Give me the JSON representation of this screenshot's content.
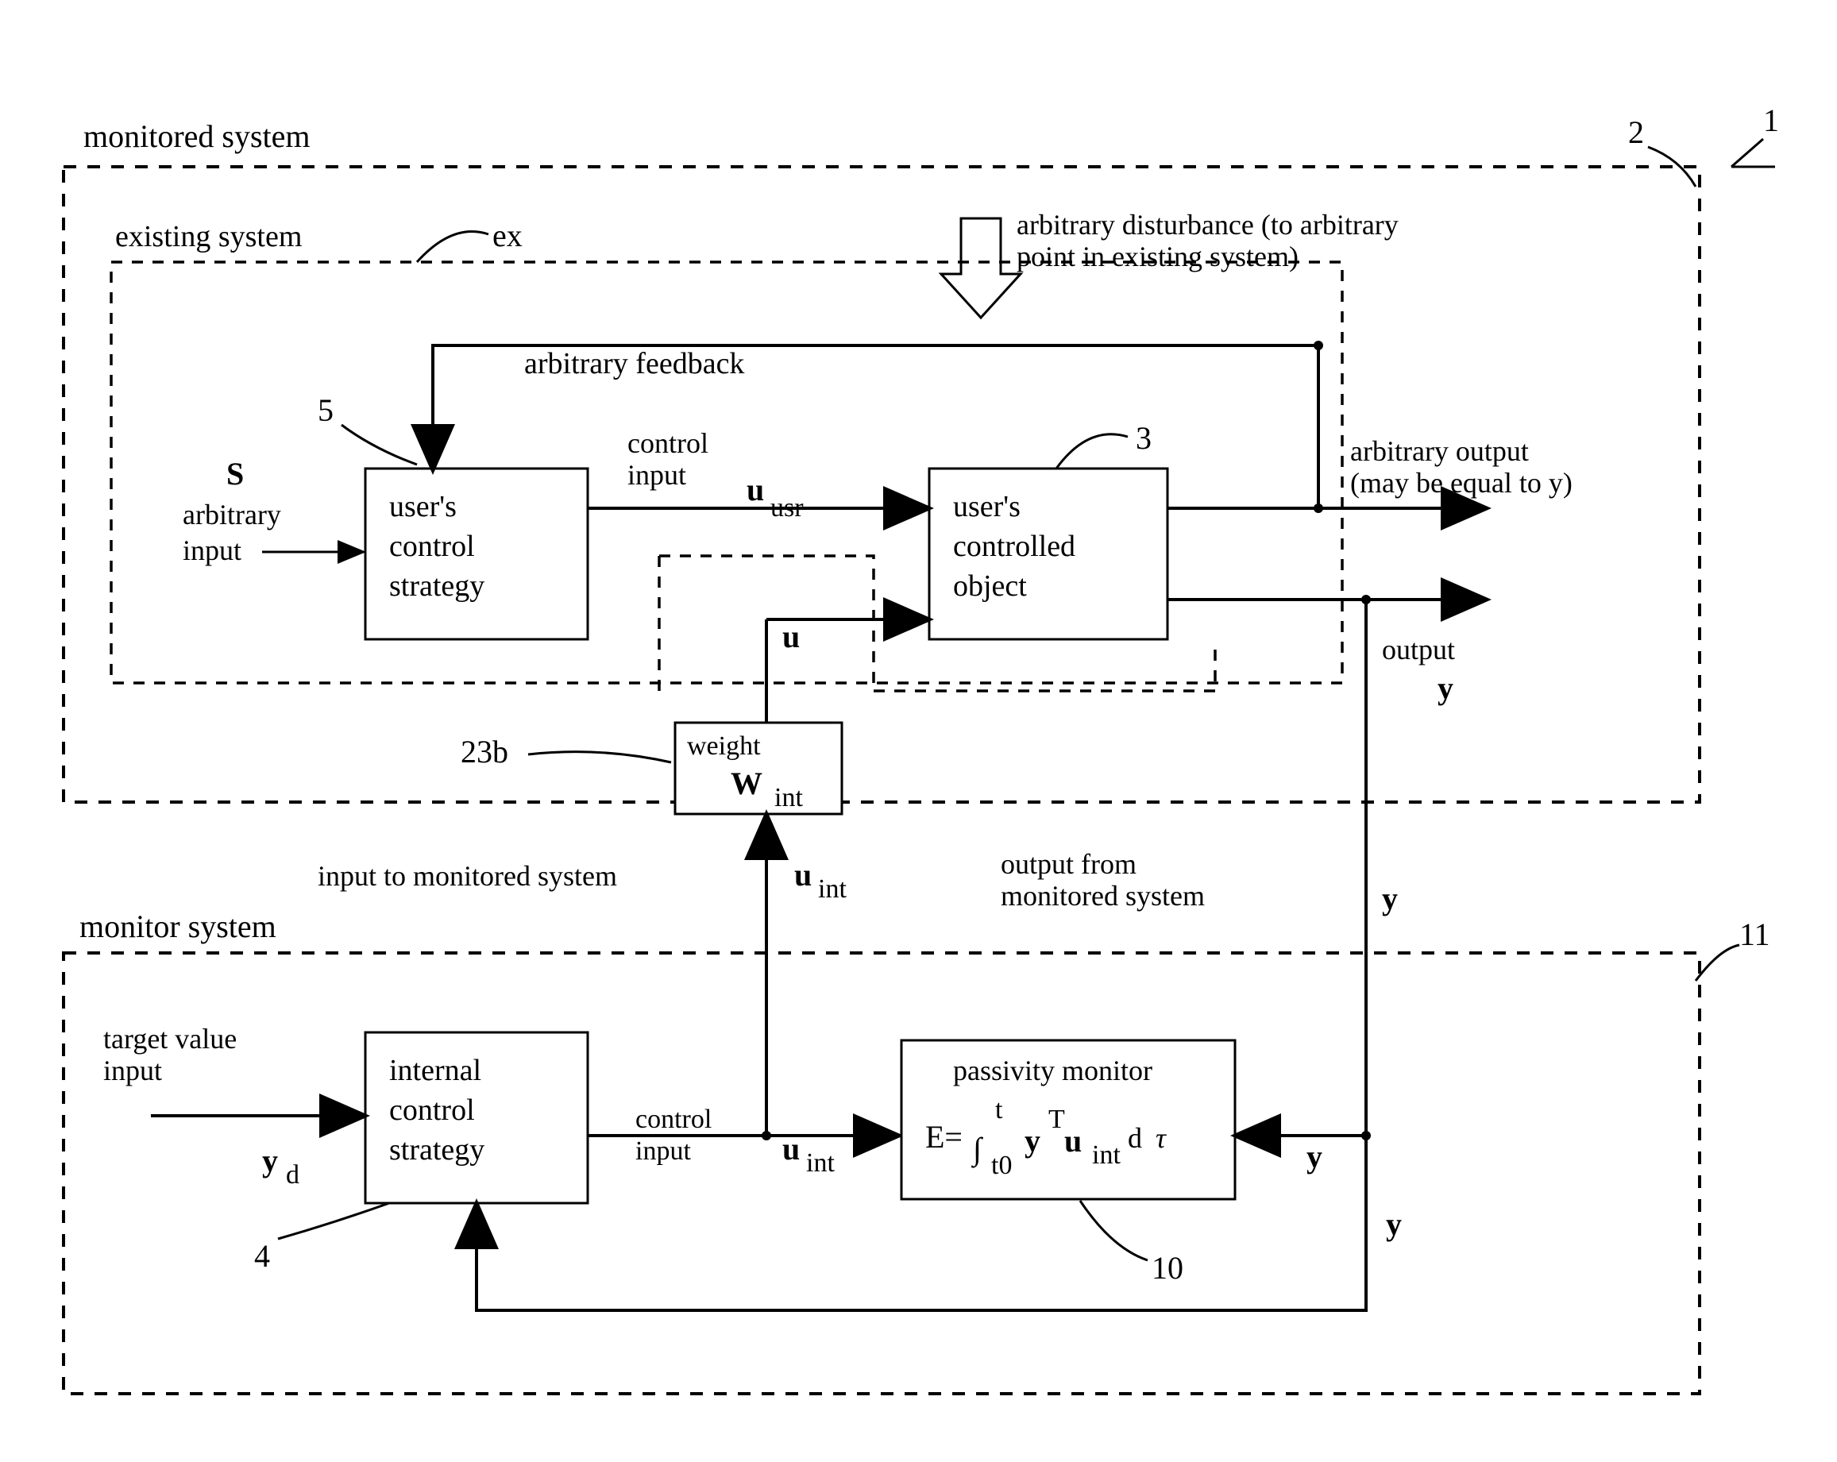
{
  "title_monitored": "monitored system",
  "title_existing": "existing system",
  "title_monitor": "monitor system",
  "labels": {
    "ex": "ex",
    "n1": "1",
    "n2": "2",
    "n3": "3",
    "n4": "4",
    "n5": "5",
    "n10": "10",
    "n11": "11",
    "n23b": "23b",
    "arb_feedback": "arbitrary feedback",
    "arb_dist1": "arbitrary disturbance (to arbitrary",
    "arb_dist2": "point in existing system)",
    "control_input": "control input",
    "control_input2": "control\ninput",
    "u_usr": "u",
    "u_usr_sub": "usr",
    "u": "u",
    "u_int": "u",
    "u_int_sub": "int",
    "W_int": "W",
    "W_int_sub": "int",
    "weight": "weight",
    "input_mon": "input to monitored system",
    "output_mon": "output from\nmonitored system",
    "target": "target value\ninput",
    "internal": "internal\ncontrol\nstrategy",
    "users_strat": "user's\ncontrol\nstrategy",
    "users_obj": "user's\ncontrolled\nobject",
    "passivity": "passivity monitor",
    "E": "E=",
    "arb_input": "arbitrary\ninput",
    "S": "S",
    "arb_output1": "arbitrary output",
    "arb_output2": "(may be equal to y)",
    "output": "output",
    "y": "y",
    "yd": "y",
    "yd_sub": "d"
  }
}
